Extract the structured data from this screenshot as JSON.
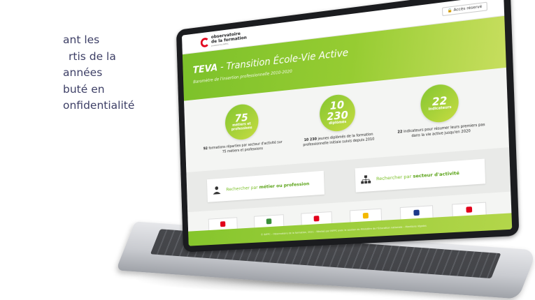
{
  "side_text": {
    "lines": [
      "ant les",
      "rtis de la",
      "années",
      "buté en",
      "onfidentialité"
    ]
  },
  "site": {
    "logo": {
      "line1": "observatoire",
      "line2": "de la formation",
      "sub": "powered by INFPC"
    },
    "access_button": "Accès réservé",
    "hero": {
      "title_bold": "TEVA",
      "title_rest": " - Transition École-Vie Active",
      "subtitle": "Baromètre de l'insertion professionnelle 2010-2020"
    },
    "stats": [
      {
        "number": "75",
        "label": "métiers et professions",
        "desc_bold": "92",
        "desc_rest": " formations réparties par secteur d'activité sur 75 métiers et professions"
      },
      {
        "number": "10 230",
        "label": "diplômés",
        "desc_bold": "10 230",
        "desc_rest": " jeunes diplômés de la formation professionnelle initiale suivis depuis 2010"
      },
      {
        "number": "22",
        "label": "indicateurs",
        "desc_bold": "22",
        "desc_rest": " indicateurs pour résumer leurs premiers pas dans la vie active jusqu'en 2020"
      }
    ],
    "search": [
      {
        "prefix": "Rechercher par ",
        "strong": "métier ou profession"
      },
      {
        "prefix": "Rechercher par ",
        "strong": "secteur d'activité"
      }
    ],
    "partners": [
      {
        "color": "#e2001a"
      },
      {
        "color": "#3a8f3a"
      },
      {
        "color": "#e2001a"
      },
      {
        "color": "#f3b800"
      },
      {
        "color": "#1d3a8a"
      },
      {
        "color": "#e2001a"
      }
    ],
    "footer": "© INFPC – Observatoire de la formation, 2021 – Réalisé par INFPC avec le soutien du Ministère de l'Éducation nationale – Mentions légales"
  },
  "colors": {
    "accent_green": "#7cc12a",
    "text_navy": "#3d3f66",
    "logo_red": "#e2001a"
  }
}
